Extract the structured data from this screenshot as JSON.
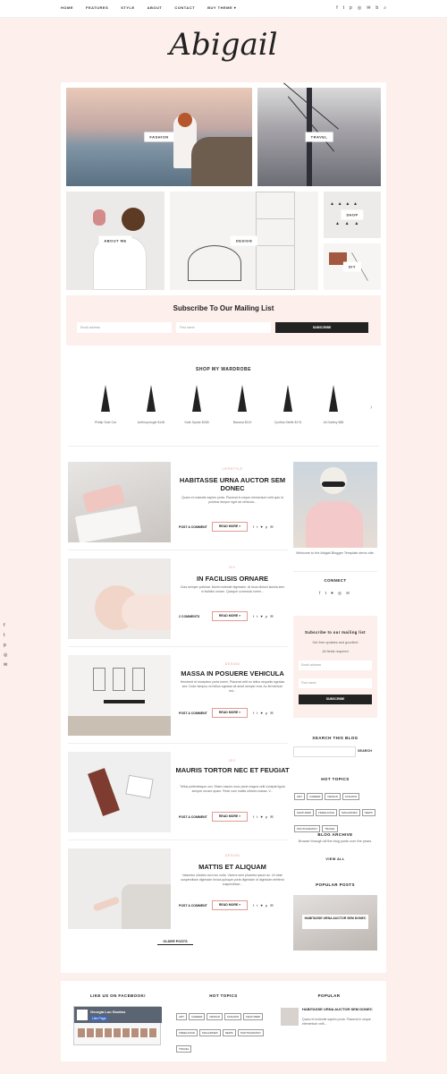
{
  "nav": {
    "items": [
      "HOME",
      "FEATURES",
      "STYLE",
      "ABOUT",
      "CONTACT",
      "BUY THEME ▾"
    ],
    "social_icons": [
      "f",
      "t",
      "p",
      "◎",
      "✉",
      "b",
      "⌕"
    ]
  },
  "logo": "Abigail",
  "featured": [
    {
      "label": "FASHION"
    },
    {
      "label": "TRAVEL"
    },
    {
      "label": "ABOUT ME"
    },
    {
      "label": "DESIGN"
    },
    {
      "label": "SHOP"
    },
    {
      "label": "DIY"
    }
  ],
  "subscribe": {
    "title": "Subscribe To Our Mailing List",
    "email_placeholder": "Email address",
    "name_placeholder": "First name",
    "button": "SUBSCRIBE"
  },
  "wardrobe": {
    "title": "SHOP MY WARDROBE",
    "items": [
      {
        "caption": "Phillip Sold Out"
      },
      {
        "caption": "Anthropologie $148"
      },
      {
        "caption": "Kate Spade $268"
      },
      {
        "caption": "Banana $119"
      },
      {
        "caption": "Cynthia Steffe $176"
      },
      {
        "caption": "Ali Gallery $88"
      }
    ],
    "next_arrow": "›"
  },
  "posts": [
    {
      "category": "LIFESTYLE",
      "title": "HABITASSE URNA AUCTOR SEM DONEC",
      "excerpt": "Quam et molestie sapien porta. Placerat in neque elementum velit quis id pulvinar tempor eget ad vehicula...",
      "comments": "POST A COMMENT",
      "more": "READ MORE »",
      "share": "f t ♥ p ✉"
    },
    {
      "category": "DIY",
      "title": "IN FACILISIS ORNARE",
      "excerpt": "Cras semper pulvinar. Morbi molestie dignissim. At risus dictum lacinia sem in facilisis ornare. Quisque commodo lorem...",
      "comments": "2 COMMENTS",
      "more": "READ MORE »",
      "share": "f t ♥ p ✉"
    },
    {
      "category": "DESIGN",
      "title": "MASSA IN POSUERE VEHICULA",
      "excerpt": "Hendrerit et excepteur porta lorem. Placerat velit eu tellus nequelis egestas sed. Dolor tempus vel tellus egestas sit amet semper erat. Ac fermentum est...",
      "comments": "POST A COMMENT",
      "more": "READ MORE »",
      "share": "f t ♥ p ✉"
    },
    {
      "category": "DIY",
      "title": "MAURIS TORTOR NEC ET FEUGIAT",
      "excerpt": "Tellus pellentesque orci. Etiam mauris nunc pede magna velit volutpat ligula semper ornare quam. Pede cum mattis ultrices massa. V...",
      "comments": "POST A COMMENT",
      "more": "READ MORE »",
      "share": "f t ♥ p ✉"
    },
    {
      "category": "DESIGN",
      "title": "MATTIS ET ALIQUAM",
      "excerpt": "Nascetur ultricies sed nec nulla. Viverra sem pharetra ipsum ac. Ut vitae suspendisse dignissim lectus quisque porta dignissim id dignissim eleifend suspendisse...",
      "comments": "POST A COMMENT",
      "more": "READ MORE »",
      "share": "f t ♥ p ✉"
    }
  ],
  "older_posts": "OLDER POSTS",
  "sidebar": {
    "welcome": "Welcome to the Abigail Blogger Template demo site.",
    "connect_title": "CONNECT",
    "connect_icons": "f t ♥ ◎ ✉",
    "mail_title": "Subscribe to our mailing list",
    "mail_text": "Get free updates and goodies!",
    "mail_required": "All fields required",
    "mail_email": "Email address",
    "mail_name": "First name",
    "mail_button": "SUBSCRIBE",
    "search_title": "SEARCH THIS BLOG",
    "search_button": "SEARCH",
    "topics_title": "HOT TOPICS",
    "topics": [
      "ART",
      "CAREER",
      "DESIGN",
      "FASHION",
      "FEATURED",
      "FREELANCE",
      "MAGAZINES",
      "NEWS",
      "PHOTOGRAPHY",
      "TRAVEL"
    ],
    "archive_title": "BLOG ARCHIVE",
    "archive_text": "Browse through all the blog posts over the years.",
    "archive_link": "VIEW ALL",
    "popular_title": "POPULAR POSTS",
    "popular_caption": "HABITASSE URNA AUCTOR SEM DONEC"
  },
  "footer": {
    "facebook_title": "LIKE US ON FACEBOOK!",
    "facebook_page": "Georgia Lou Studios",
    "facebook_like": "Like Page",
    "topics_title": "HOT TOPICS",
    "topics": [
      "ART",
      "CAREER",
      "DESIGN",
      "FASHION",
      "FEATURED",
      "FREELANCE",
      "MAGAZINES",
      "NEWS",
      "PHOTOGRAPHY",
      "TRAVEL"
    ],
    "popular_title": "POPULAR",
    "popular_post": "HABITASSE URNA AUCTOR SEM DONEC",
    "popular_excerpt": "Quam et molestie sapien porta. Placerat in neque elementum velit..."
  },
  "float_social": [
    "f",
    "t",
    "p",
    "◎",
    "✉"
  ],
  "colors": {
    "accent": "#e29b92",
    "bg": "#fcefec",
    "dark": "#222222"
  }
}
